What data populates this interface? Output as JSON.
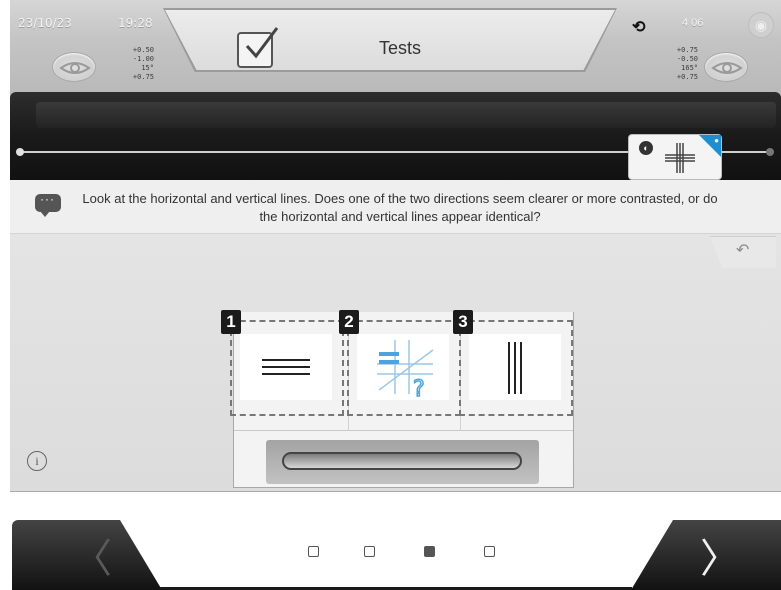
{
  "header": {
    "date": "23/10/23",
    "time": "19:28",
    "title": "Tests",
    "timer": "4 06",
    "left_rx": [
      "+0.50",
      "-1.00",
      "15°",
      "+0.75"
    ],
    "right_rx": [
      "+0.75",
      "-0.50",
      "165°",
      "+0.75"
    ]
  },
  "instruction": "Look at the horizontal and vertical lines. Does one of the two directions seem clearer or more contrasted, or do the horizontal and vertical lines appear identical?",
  "options": [
    {
      "number": "1",
      "icon": "horizontal-lines-clearer-icon"
    },
    {
      "number": "2",
      "icon": "unsure-question-icon"
    },
    {
      "number": "3",
      "icon": "vertical-lines-clearer-icon"
    }
  ],
  "pagination": {
    "total": 4,
    "active": 3
  },
  "icons": {
    "sync": "⟲",
    "power": "◉",
    "back": "↶",
    "info": "i",
    "prev": "〈",
    "next": "〉"
  },
  "colors": {
    "accent": "#1d8fd0",
    "dark": "#1b1b1b"
  }
}
